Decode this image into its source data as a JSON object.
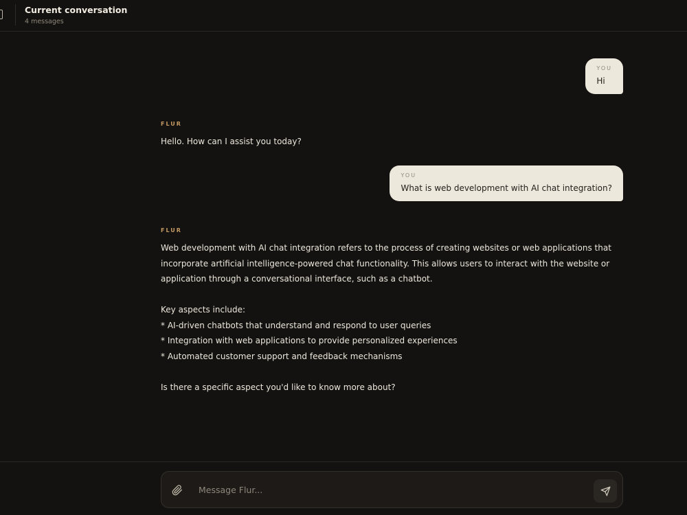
{
  "header": {
    "title": "Current conversation",
    "message_count": "4 messages"
  },
  "messages": [
    {
      "role": "YOU",
      "text": "Hi"
    },
    {
      "role": "FLUR",
      "lines": [
        "Hello. How can I assist you today?"
      ]
    },
    {
      "role": "YOU",
      "text": "What is web development with AI chat integration?"
    },
    {
      "role": "FLUR",
      "lines": [
        "Web development with AI chat integration refers to the process of creating websites or web applications that",
        "incorporate artificial intelligence-powered chat functionality. This allows users to interact with the website or",
        "application through a conversational interface, such as a chatbot.",
        "",
        "Key aspects include:",
        "* AI-driven chatbots that understand and respond to user queries",
        "* Integration with web applications to provide personalized experiences",
        "* Automated customer support and feedback mechanisms",
        "",
        "Is there a specific aspect you'd like to know more about?"
      ]
    }
  ],
  "composer": {
    "placeholder": "Message Flur...",
    "value": ""
  },
  "icons": {
    "sidebar_toggle": "sidebar-toggle-icon",
    "attach": "paperclip-icon",
    "send": "send-icon"
  },
  "colors": {
    "background": "#141210",
    "user_bubble": "#ede8dc",
    "assistant_label": "#c49a62"
  }
}
